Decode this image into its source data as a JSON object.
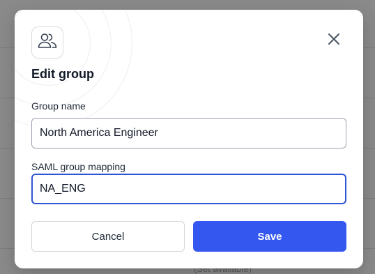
{
  "backdrop": {
    "partial_text": "(Set available)"
  },
  "dialog": {
    "title": "Edit group",
    "icon": "users-icon",
    "close_icon": "close-icon",
    "fields": {
      "group_name": {
        "label": "Group name",
        "value": "North America Engineer"
      },
      "saml_mapping": {
        "label": "SAML group mapping",
        "value": "NA_ENG"
      }
    },
    "buttons": {
      "cancel": "Cancel",
      "save": "Save"
    }
  },
  "colors": {
    "primary": "#3457f0",
    "focus_border": "#2f55d4",
    "overlay": "#8a8a8a"
  }
}
